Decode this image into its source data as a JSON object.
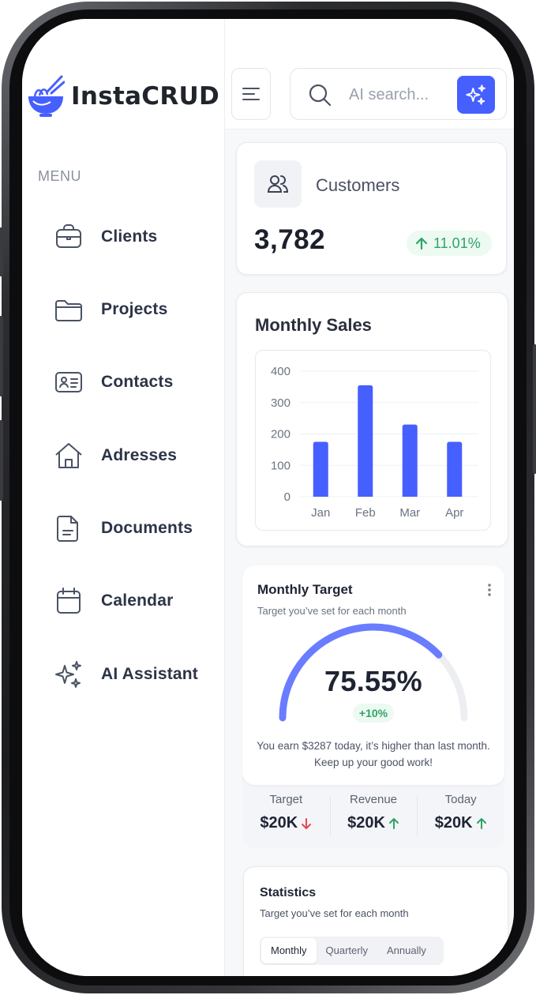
{
  "app": {
    "name": "InstaCRUD"
  },
  "sidebar": {
    "menu_label": "MENU",
    "items": [
      {
        "label": "Clients",
        "icon": "briefcase-icon"
      },
      {
        "label": "Projects",
        "icon": "folder-icon"
      },
      {
        "label": "Contacts",
        "icon": "contact-card-icon"
      },
      {
        "label": "Adresses",
        "icon": "home-icon"
      },
      {
        "label": "Documents",
        "icon": "document-icon"
      },
      {
        "label": "Calendar",
        "icon": "calendar-icon"
      },
      {
        "label": "AI Assistant",
        "icon": "sparkles-icon"
      }
    ]
  },
  "search": {
    "placeholder": "AI search..."
  },
  "customers": {
    "title": "Customers",
    "value": "3,782",
    "change": "11.01%"
  },
  "monthly_sales": {
    "title": "Monthly Sales"
  },
  "chart_data": {
    "type": "bar",
    "title": "Monthly Sales",
    "categories": [
      "Jan",
      "Feb",
      "Mar",
      "Apr"
    ],
    "values": [
      175,
      355,
      230,
      175
    ],
    "yticks": [
      "0",
      "100",
      "200",
      "300",
      "400"
    ],
    "ylim": [
      0,
      400
    ],
    "grid": true,
    "color": "#465fff"
  },
  "target": {
    "title": "Monthly Target",
    "subtitle": "Target you’ve set for each month",
    "percent": "75.55%",
    "progress": 0.7555,
    "badge": "+10%",
    "note_line1": "You earn $3287 today, it’s higher than last month.",
    "note_line2": "Keep up your good work!",
    "stats": [
      {
        "label": "Target",
        "value": "$20K",
        "trend": "down"
      },
      {
        "label": "Revenue",
        "value": "$20K",
        "trend": "up"
      },
      {
        "label": "Today",
        "value": "$20K",
        "trend": "up"
      }
    ]
  },
  "statistics": {
    "title": "Statistics",
    "subtitle": "Target you’ve set for each month",
    "tabs": [
      "Monthly",
      "Quarterly",
      "Annually"
    ],
    "active_tab": "Monthly"
  },
  "colors": {
    "accent": "#465fff",
    "up": "#2fa368",
    "down": "#e5484d",
    "track": "#eceef2"
  }
}
